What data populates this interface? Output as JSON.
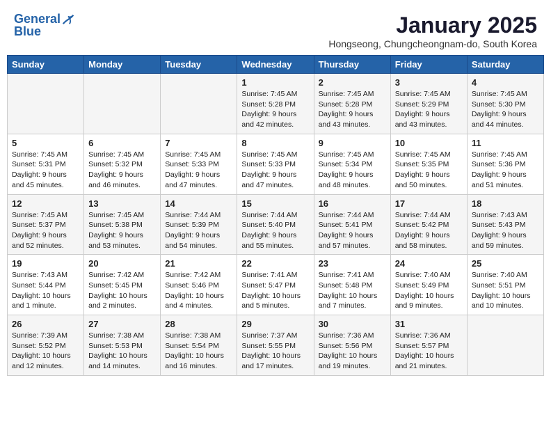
{
  "header": {
    "logo_line1": "General",
    "logo_line2": "Blue",
    "month_title": "January 2025",
    "subtitle": "Hongseong, Chungcheongnam-do, South Korea"
  },
  "weekdays": [
    "Sunday",
    "Monday",
    "Tuesday",
    "Wednesday",
    "Thursday",
    "Friday",
    "Saturday"
  ],
  "weeks": [
    [
      {
        "day": "",
        "info": ""
      },
      {
        "day": "",
        "info": ""
      },
      {
        "day": "",
        "info": ""
      },
      {
        "day": "1",
        "info": "Sunrise: 7:45 AM\nSunset: 5:28 PM\nDaylight: 9 hours\nand 42 minutes."
      },
      {
        "day": "2",
        "info": "Sunrise: 7:45 AM\nSunset: 5:28 PM\nDaylight: 9 hours\nand 43 minutes."
      },
      {
        "day": "3",
        "info": "Sunrise: 7:45 AM\nSunset: 5:29 PM\nDaylight: 9 hours\nand 43 minutes."
      },
      {
        "day": "4",
        "info": "Sunrise: 7:45 AM\nSunset: 5:30 PM\nDaylight: 9 hours\nand 44 minutes."
      }
    ],
    [
      {
        "day": "5",
        "info": "Sunrise: 7:45 AM\nSunset: 5:31 PM\nDaylight: 9 hours\nand 45 minutes."
      },
      {
        "day": "6",
        "info": "Sunrise: 7:45 AM\nSunset: 5:32 PM\nDaylight: 9 hours\nand 46 minutes."
      },
      {
        "day": "7",
        "info": "Sunrise: 7:45 AM\nSunset: 5:33 PM\nDaylight: 9 hours\nand 47 minutes."
      },
      {
        "day": "8",
        "info": "Sunrise: 7:45 AM\nSunset: 5:33 PM\nDaylight: 9 hours\nand 47 minutes."
      },
      {
        "day": "9",
        "info": "Sunrise: 7:45 AM\nSunset: 5:34 PM\nDaylight: 9 hours\nand 48 minutes."
      },
      {
        "day": "10",
        "info": "Sunrise: 7:45 AM\nSunset: 5:35 PM\nDaylight: 9 hours\nand 50 minutes."
      },
      {
        "day": "11",
        "info": "Sunrise: 7:45 AM\nSunset: 5:36 PM\nDaylight: 9 hours\nand 51 minutes."
      }
    ],
    [
      {
        "day": "12",
        "info": "Sunrise: 7:45 AM\nSunset: 5:37 PM\nDaylight: 9 hours\nand 52 minutes."
      },
      {
        "day": "13",
        "info": "Sunrise: 7:45 AM\nSunset: 5:38 PM\nDaylight: 9 hours\nand 53 minutes."
      },
      {
        "day": "14",
        "info": "Sunrise: 7:44 AM\nSunset: 5:39 PM\nDaylight: 9 hours\nand 54 minutes."
      },
      {
        "day": "15",
        "info": "Sunrise: 7:44 AM\nSunset: 5:40 PM\nDaylight: 9 hours\nand 55 minutes."
      },
      {
        "day": "16",
        "info": "Sunrise: 7:44 AM\nSunset: 5:41 PM\nDaylight: 9 hours\nand 57 minutes."
      },
      {
        "day": "17",
        "info": "Sunrise: 7:44 AM\nSunset: 5:42 PM\nDaylight: 9 hours\nand 58 minutes."
      },
      {
        "day": "18",
        "info": "Sunrise: 7:43 AM\nSunset: 5:43 PM\nDaylight: 9 hours\nand 59 minutes."
      }
    ],
    [
      {
        "day": "19",
        "info": "Sunrise: 7:43 AM\nSunset: 5:44 PM\nDaylight: 10 hours\nand 1 minute."
      },
      {
        "day": "20",
        "info": "Sunrise: 7:42 AM\nSunset: 5:45 PM\nDaylight: 10 hours\nand 2 minutes."
      },
      {
        "day": "21",
        "info": "Sunrise: 7:42 AM\nSunset: 5:46 PM\nDaylight: 10 hours\nand 4 minutes."
      },
      {
        "day": "22",
        "info": "Sunrise: 7:41 AM\nSunset: 5:47 PM\nDaylight: 10 hours\nand 5 minutes."
      },
      {
        "day": "23",
        "info": "Sunrise: 7:41 AM\nSunset: 5:48 PM\nDaylight: 10 hours\nand 7 minutes."
      },
      {
        "day": "24",
        "info": "Sunrise: 7:40 AM\nSunset: 5:49 PM\nDaylight: 10 hours\nand 9 minutes."
      },
      {
        "day": "25",
        "info": "Sunrise: 7:40 AM\nSunset: 5:51 PM\nDaylight: 10 hours\nand 10 minutes."
      }
    ],
    [
      {
        "day": "26",
        "info": "Sunrise: 7:39 AM\nSunset: 5:52 PM\nDaylight: 10 hours\nand 12 minutes."
      },
      {
        "day": "27",
        "info": "Sunrise: 7:38 AM\nSunset: 5:53 PM\nDaylight: 10 hours\nand 14 minutes."
      },
      {
        "day": "28",
        "info": "Sunrise: 7:38 AM\nSunset: 5:54 PM\nDaylight: 10 hours\nand 16 minutes."
      },
      {
        "day": "29",
        "info": "Sunrise: 7:37 AM\nSunset: 5:55 PM\nDaylight: 10 hours\nand 17 minutes."
      },
      {
        "day": "30",
        "info": "Sunrise: 7:36 AM\nSunset: 5:56 PM\nDaylight: 10 hours\nand 19 minutes."
      },
      {
        "day": "31",
        "info": "Sunrise: 7:36 AM\nSunset: 5:57 PM\nDaylight: 10 hours\nand 21 minutes."
      },
      {
        "day": "",
        "info": ""
      }
    ]
  ]
}
